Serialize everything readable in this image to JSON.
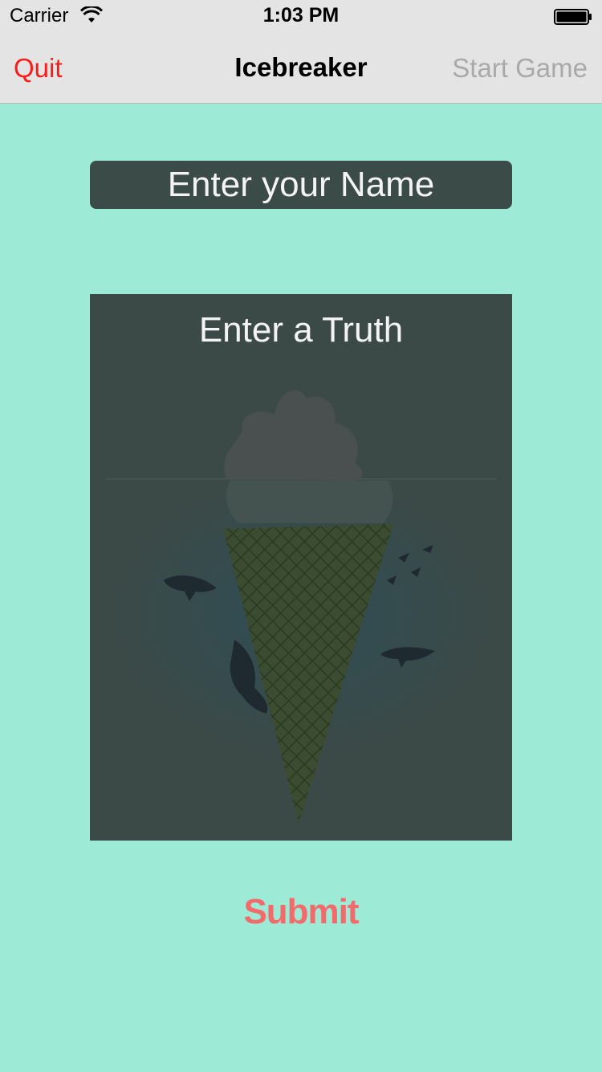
{
  "status": {
    "carrier": "Carrier",
    "time": "1:03 PM"
  },
  "nav": {
    "quit_label": "Quit",
    "title": "Icebreaker",
    "start_label": "Start Game"
  },
  "form": {
    "name_placeholder": "Enter your Name",
    "truth_label": "Enter a Truth",
    "submit_label": "Submit"
  },
  "colors": {
    "background": "#9DEBD7",
    "quit": "#FF1A1A",
    "disabled": "#A9A9A9",
    "submit": "#F36A6A",
    "panel": "#3B4A47"
  }
}
